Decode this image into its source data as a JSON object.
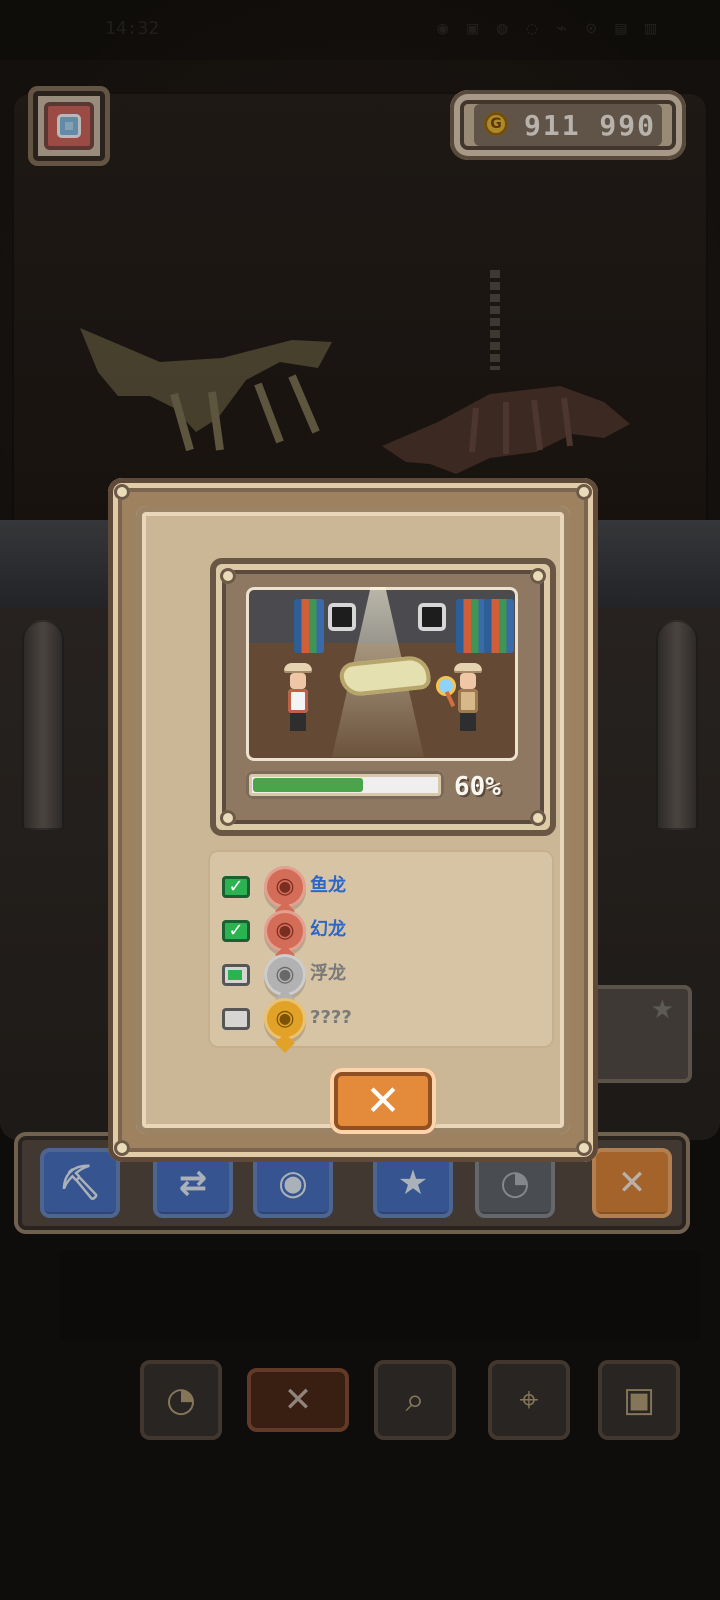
{
  "status_bar": {
    "time": "14:32",
    "icons": "◉ ▣ ◍ ◌ ⌁ ⊙ ▤ ▥"
  },
  "top": {
    "camera_icon": "camera-icon",
    "coins": "911 990"
  },
  "modal": {
    "progress_percent": "60%",
    "progress_value": 60,
    "items": [
      {
        "checked": "true",
        "icon_color": "red",
        "label": "鱼龙"
      },
      {
        "checked": "true",
        "icon_color": "red",
        "label": "幻龙"
      },
      {
        "checked": "partial",
        "icon_color": "gray",
        "label": "浮龙"
      },
      {
        "checked": "false",
        "icon_color": "gold",
        "label": "????"
      }
    ],
    "close_icon": "close-icon"
  },
  "toolbar": {
    "buttons": [
      {
        "name": "pickaxe-icon",
        "glyph": "⛏"
      },
      {
        "name": "refresh-icon",
        "glyph": "⇄"
      },
      {
        "name": "money-bag-icon",
        "glyph": "◉"
      },
      {
        "name": "star-icon",
        "glyph": "★"
      },
      {
        "name": "lightbulb-icon",
        "glyph": "◔"
      },
      {
        "name": "close-icon",
        "glyph": "✕"
      }
    ]
  },
  "dock": {
    "items": [
      {
        "name": "lightbulb-icon",
        "glyph": "◔"
      },
      {
        "name": "close-icon",
        "glyph": "✕"
      },
      {
        "name": "search-icon",
        "glyph": "⌕"
      },
      {
        "name": "map-icon",
        "glyph": "⌖"
      },
      {
        "name": "book-icon",
        "glyph": "▣"
      }
    ]
  }
}
